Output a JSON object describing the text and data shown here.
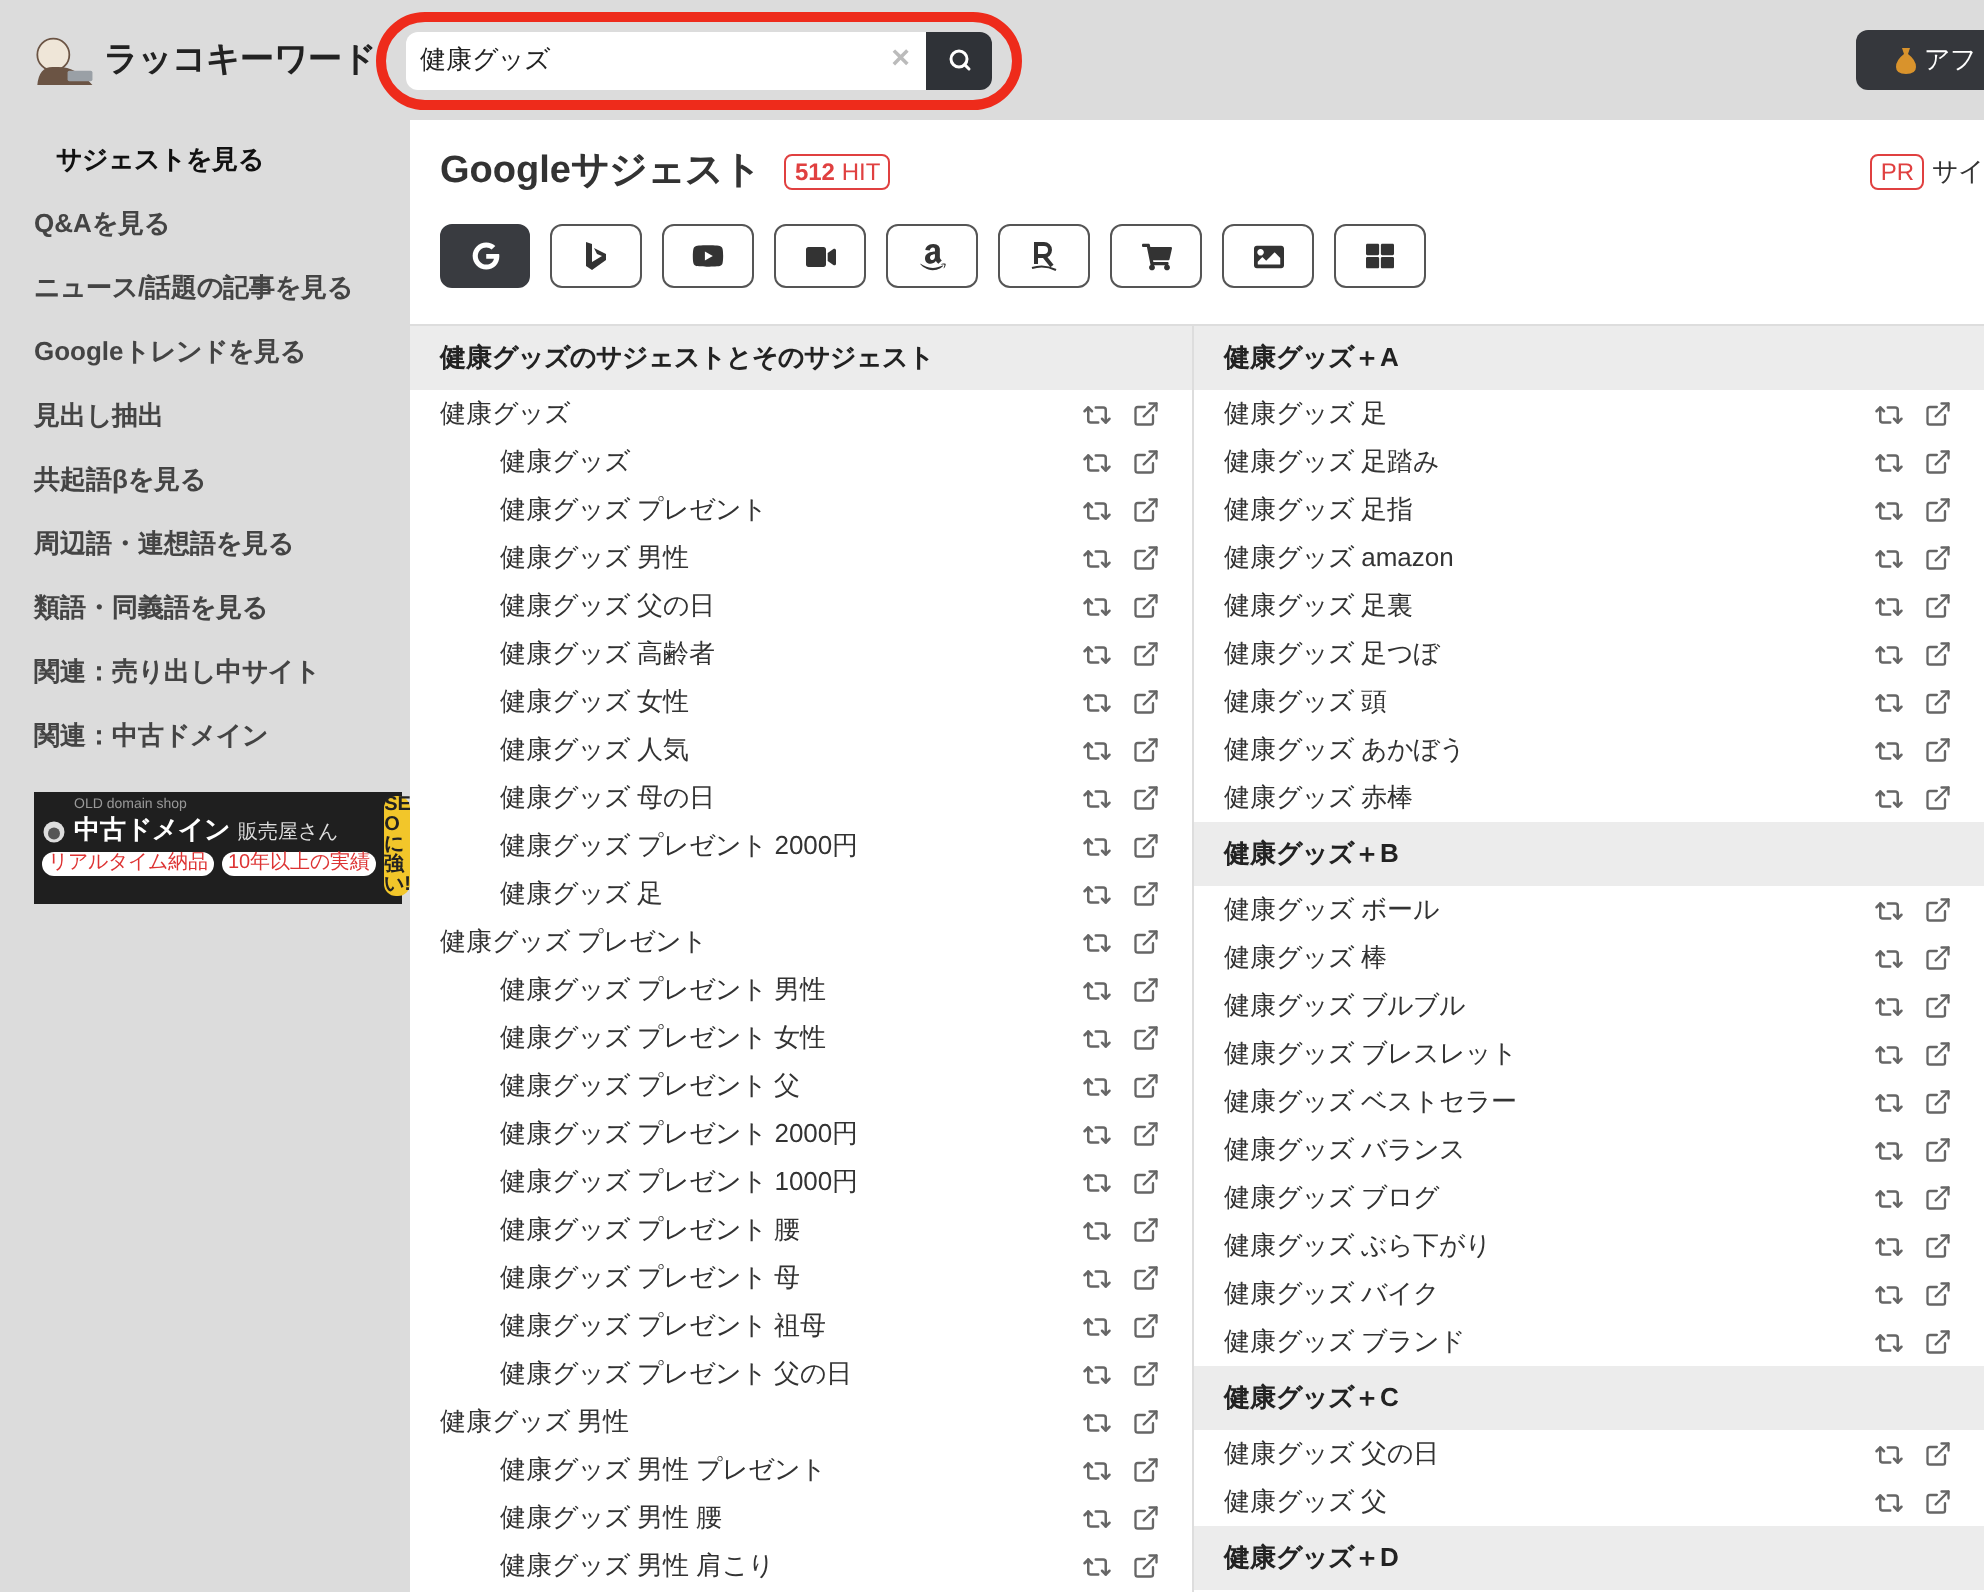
{
  "header": {
    "logo": "ラッコキーワード",
    "search": {
      "value": "健康グッズ",
      "clear": "×"
    },
    "affiliate_button": "アフ"
  },
  "sidebar": {
    "items": [
      {
        "label": "サジェストを見る",
        "selected": true
      },
      {
        "label": "Q&Aを見る",
        "selected": false
      },
      {
        "label": "ニュース/話題の記事を見る",
        "selected": false
      },
      {
        "label": "Googleトレンドを見る",
        "selected": false
      },
      {
        "label": "見出し抽出",
        "selected": false
      },
      {
        "label": "共起語βを見る",
        "selected": false
      },
      {
        "label": "周辺語・連想語を見る",
        "selected": false
      },
      {
        "label": "類語・同義語を見る",
        "selected": false
      },
      {
        "label": "関連：売り出し中サイト",
        "selected": false
      },
      {
        "label": "関連：中古ドメイン",
        "selected": false
      }
    ],
    "banner": {
      "tagline": "OLD domain shop",
      "title": "中古ドメイン",
      "subtitle": "販売屋さん",
      "badge": "SEOに強い!",
      "pills": [
        "リアルタイム納品",
        "10年以上の実績"
      ]
    }
  },
  "main": {
    "title": "Googleサジェスト",
    "hit_count": "512",
    "hit_label": "HIT",
    "pr": "PR",
    "pr_text": "サイ",
    "sources": [
      {
        "kind": "google",
        "selected": true
      },
      {
        "kind": "bing",
        "selected": false
      },
      {
        "kind": "youtube",
        "selected": false
      },
      {
        "kind": "video",
        "selected": false
      },
      {
        "kind": "amazon",
        "selected": false
      },
      {
        "kind": "rakuten",
        "selected": false
      },
      {
        "kind": "cart",
        "selected": false
      },
      {
        "kind": "image",
        "selected": false
      },
      {
        "kind": "grid",
        "selected": false
      }
    ],
    "left_column": {
      "heading": "健康グッズのサジェストとそのサジェスト",
      "items": [
        {
          "text": "健康グッズ",
          "children": [
            {
              "text": "健康グッズ"
            },
            {
              "text": "健康グッズ プレゼント"
            },
            {
              "text": "健康グッズ 男性"
            },
            {
              "text": "健康グッズ 父の日"
            },
            {
              "text": "健康グッズ 高齢者"
            },
            {
              "text": "健康グッズ 女性"
            },
            {
              "text": "健康グッズ 人気"
            },
            {
              "text": "健康グッズ 母の日"
            },
            {
              "text": "健康グッズ プレゼント 2000円"
            },
            {
              "text": "健康グッズ 足"
            }
          ]
        },
        {
          "text": "健康グッズ プレゼント",
          "children": [
            {
              "text": "健康グッズ プレゼント 男性"
            },
            {
              "text": "健康グッズ プレゼント 女性"
            },
            {
              "text": "健康グッズ プレゼント 父"
            },
            {
              "text": "健康グッズ プレゼント 2000円"
            },
            {
              "text": "健康グッズ プレゼント 1000円"
            },
            {
              "text": "健康グッズ プレゼント 腰"
            },
            {
              "text": "健康グッズ プレゼント 母"
            },
            {
              "text": "健康グッズ プレゼント 祖母"
            },
            {
              "text": "健康グッズ プレゼント 父の日"
            }
          ]
        },
        {
          "text": "健康グッズ 男性",
          "children": [
            {
              "text": "健康グッズ 男性 プレゼント"
            },
            {
              "text": "健康グッズ 男性 腰"
            },
            {
              "text": "健康グッズ 男性 肩こり"
            }
          ]
        }
      ]
    },
    "right_groups": [
      {
        "heading": "健康グッズ＋A",
        "items": [
          "健康グッズ 足",
          "健康グッズ 足踏み",
          "健康グッズ 足指",
          "健康グッズ amazon",
          "健康グッズ 足裏",
          "健康グッズ 足つぼ",
          "健康グッズ 頭",
          "健康グッズ あかぼう",
          "健康グッズ 赤棒"
        ]
      },
      {
        "heading": "健康グッズ＋B",
        "items": [
          "健康グッズ ボール",
          "健康グッズ 棒",
          "健康グッズ ブルブル",
          "健康グッズ ブレスレット",
          "健康グッズ ベストセラー",
          "健康グッズ バランス",
          "健康グッズ ブログ",
          "健康グッズ ぶら下がり",
          "健康グッズ バイク",
          "健康グッズ ブランド"
        ]
      },
      {
        "heading": "健康グッズ＋C",
        "items": [
          "健康グッズ 父の日",
          "健康グッズ 父"
        ]
      },
      {
        "heading": "健康グッズ＋D"
      }
    ]
  }
}
